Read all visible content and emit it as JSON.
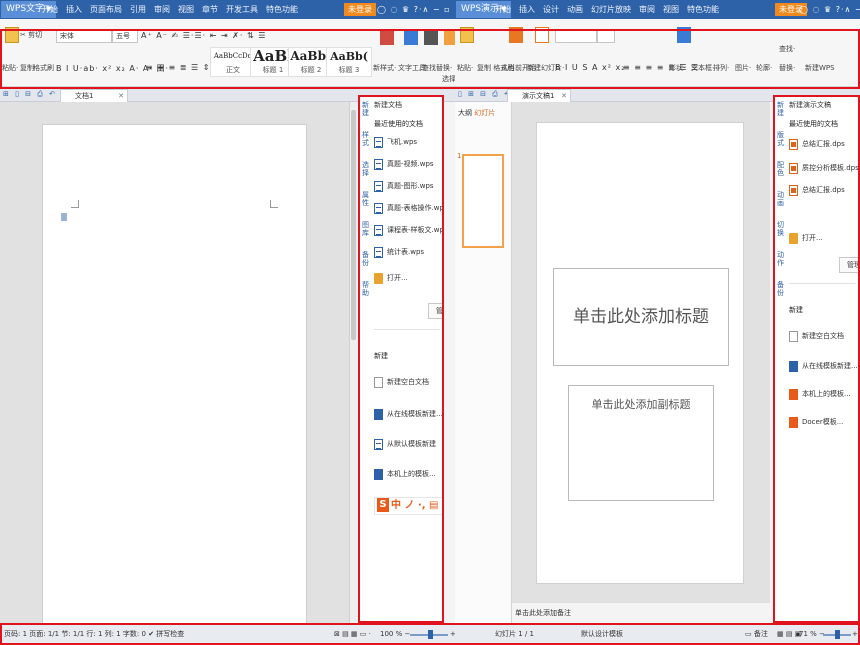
{
  "writer": {
    "app_name": "WPS文字",
    "menu": [
      "开始",
      "插入",
      "页面布局",
      "引用",
      "审阅",
      "视图",
      "章节",
      "开发工具",
      "特色功能"
    ],
    "login": "未登录",
    "window_controls": "◯ ◌ ♛ ?·∧ − ▫ ✕",
    "ribbon": {
      "clipboard": [
        "✂ 剪切",
        "复制",
        "格式刷"
      ],
      "paste": "粘贴·",
      "font_name": "宋体",
      "font_size": "五号",
      "format_row1": "A⁺ A⁻ ✍  ☰·☰·  ⇤ ⇥  ✗· ⇅  ☰",
      "format_row2": "B I U·ab· x² x₂  A·  A· 田·",
      "align_row": "≡ ≡ ≡ ≣ ☰  ⇕·  ▦·  ⊞·",
      "styles": [
        {
          "sample": "AaBbCcDd",
          "name": "正文"
        },
        {
          "sample": "AaBl",
          "name": "标题 1"
        },
        {
          "sample": "AaBb(",
          "name": "标题 2"
        },
        {
          "sample": "AaBb(",
          "name": "标题 3"
        }
      ],
      "new_style": "新样式·",
      "text_tools": "文字工具·",
      "find_replace": "查找替换·",
      "select": "选择·"
    },
    "quick_access": "⊞ ▯ ⊟ ⎙ ↶ ↷ ·",
    "doc_tab": "文档1",
    "taskpane": {
      "header": "新建文档",
      "recent_title": "最近使用的文档",
      "recent_files": [
        "飞机.wps",
        "真题-视频.wps",
        "真题-图形.wps",
        "真题-表格操作.wps",
        "课程表-样板文.wps",
        "统计表.wps"
      ],
      "open_label": "打开...",
      "manage": "管理",
      "new_title": "新建",
      "new_items": [
        "新建空白文档",
        "从在线模板新建...",
        "从默认模板新建",
        "本机上的模板..."
      ],
      "sogou_text": "中 ノ ·, ▤ 🐾 👕 /",
      "side_tabs": [
        "新建",
        "样式",
        "选择",
        "属性",
        "图库",
        "备份",
        "帮助"
      ]
    },
    "status": {
      "left": "页码: 1  页面: 1/1  节: 1/1  行: 1  列: 1  字数: 0  ✔ 拼写检查",
      "right_icons": "⊠ ▤ ▦ ▭ ·",
      "zoom": "100 % −",
      "zoom_plus": "+"
    }
  },
  "presentation": {
    "app_name": "WPS演示",
    "menu": [
      "开始",
      "插入",
      "设计",
      "动画",
      "幻灯片放映",
      "审阅",
      "视图",
      "特色功能"
    ],
    "login": "未登录",
    "window_controls": "◯ ◌ ♛ ?·∧ − ▫ ✕",
    "ribbon": {
      "paste": "粘贴·",
      "clipboard_labels": "复制  格式刷",
      "from_current": "从当前开始·",
      "new_slide": "新建幻灯片·",
      "format_row": "B I U S A  x² x₂",
      "align_row": "≡ ≡ ≡ ≡ ≣ ☰  ☰·",
      "shapes": "形状·",
      "textbox": "文本框·",
      "arrange": "排列·",
      "pic": "图片·",
      "outline": "轮廓·",
      "find": "查找·",
      "replace": "替换·",
      "new_wps": "新建WPS"
    },
    "quick_access": "▯ ⊞ ⊟ ⎙ ↶ ↷ ·",
    "doc_tab": "演示文稿1",
    "thumb_tabs": [
      "大纲",
      "幻灯片"
    ],
    "slide_number": "1",
    "slide_title_placeholder": "单击此处添加标题",
    "slide_subtitle_placeholder": "单击此处添加副标题",
    "notes_placeholder": "单击此处添加备注",
    "taskpane": {
      "header": "新建演示文稿",
      "recent_title": "最近使用的文档",
      "recent_files": [
        "总结汇报.dps",
        "质控分析模板.dps",
        "总结汇报.dps"
      ],
      "open_label": "打开...",
      "manage": "管理",
      "new_title": "新建",
      "new_items": [
        "新建空白文档",
        "从在线模板新建...",
        "本机上的模板...",
        "Docer模板..."
      ],
      "side_tabs": [
        "新建",
        "版式",
        "配色",
        "动画",
        "切换",
        "动作",
        "备份"
      ]
    },
    "status": {
      "slide": "幻灯片 1 / 1",
      "theme": "默认设计模板",
      "notes_btn": "▭ 备注",
      "icons": "▦ ▤ ▣",
      "zoom": "71 % −",
      "zoom_plus": "+"
    }
  }
}
